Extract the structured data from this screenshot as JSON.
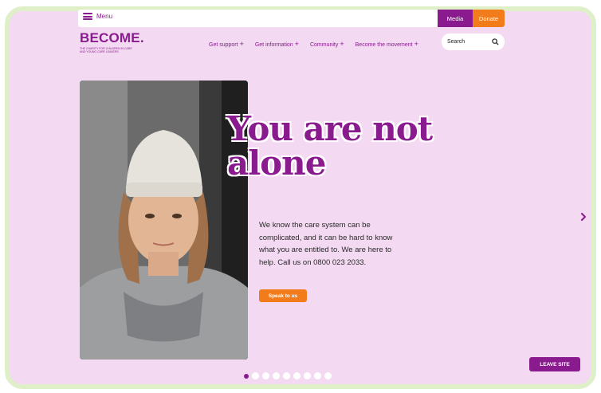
{
  "header": {
    "menu_label": "Menu",
    "media_label": "Media",
    "donate_label": "Donate"
  },
  "logo": {
    "name": "BECOME.",
    "tagline": "The charity for children in care and young care leavers"
  },
  "nav": {
    "items": [
      {
        "label": "Get support"
      },
      {
        "label": "Get information"
      },
      {
        "label": "Community"
      },
      {
        "label": "Become the movement"
      }
    ],
    "search_placeholder": "Search"
  },
  "hero": {
    "headline_line1": "You are not",
    "headline_line2": "alone",
    "body": "We know the care system can be complicated, and it can be hard to know what you are entitled to. We are here to help. Call us on 0800 023 2033.",
    "cta_label": "Speak to us",
    "slide_count": 9,
    "active_slide": 1
  },
  "leave_site_label": "LEAVE SITE",
  "colors": {
    "brand_purple": "#8a1b8e",
    "brand_orange": "#f27c1c",
    "background_pink": "#f3d9f1",
    "frame_green": "#dff0c9"
  }
}
